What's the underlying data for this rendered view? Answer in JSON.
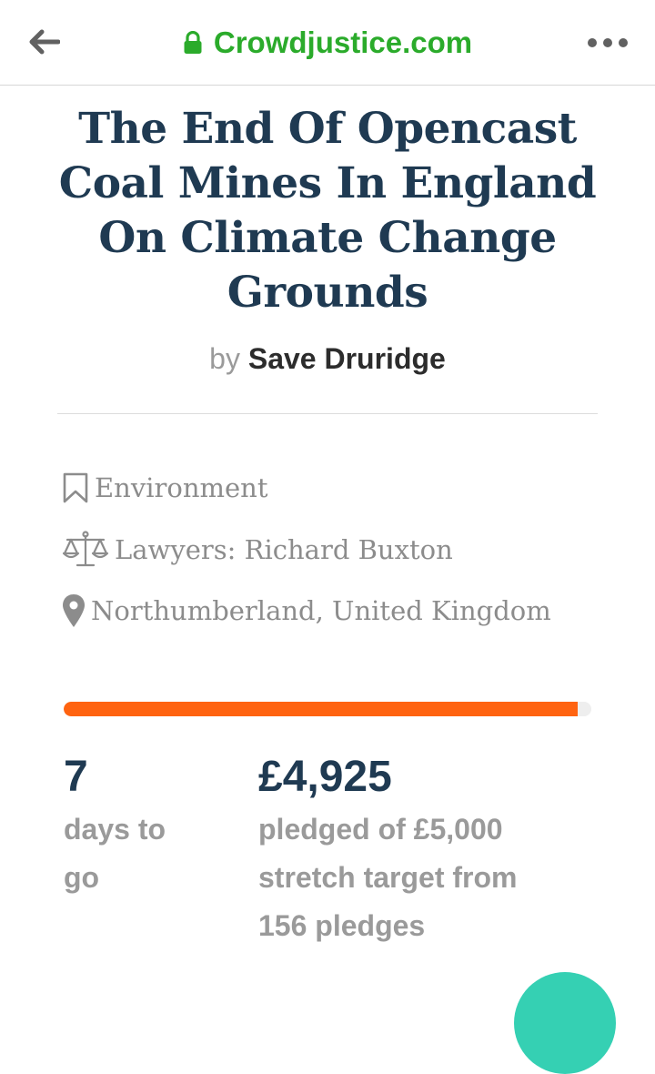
{
  "browser": {
    "domain": "Crowdjustice.com",
    "icons": {
      "back": "arrow-left-icon",
      "secure": "lock-icon",
      "menu": "more-dots-icon"
    },
    "accent_color": "#2bab2b"
  },
  "campaign": {
    "title": "The End Of Opencast Coal Mines In England On Climate Change Grounds",
    "by_label": "by",
    "author": "Save Druridge",
    "meta": {
      "category": "Environment",
      "lawyers": "Lawyers: Richard Buxton",
      "location": "Northumberland, United Kingdom"
    },
    "progress": {
      "fraction": 0.974,
      "color": "#ff6310"
    },
    "stats": {
      "days_number": "7",
      "days_label_line1": "days to",
      "days_label_line2": "go",
      "pledged_amount": "£4,925",
      "pledged_line1": "pledged of £5,000",
      "pledged_line2": "stretch target from",
      "pledged_line3": "156 pledges"
    }
  }
}
